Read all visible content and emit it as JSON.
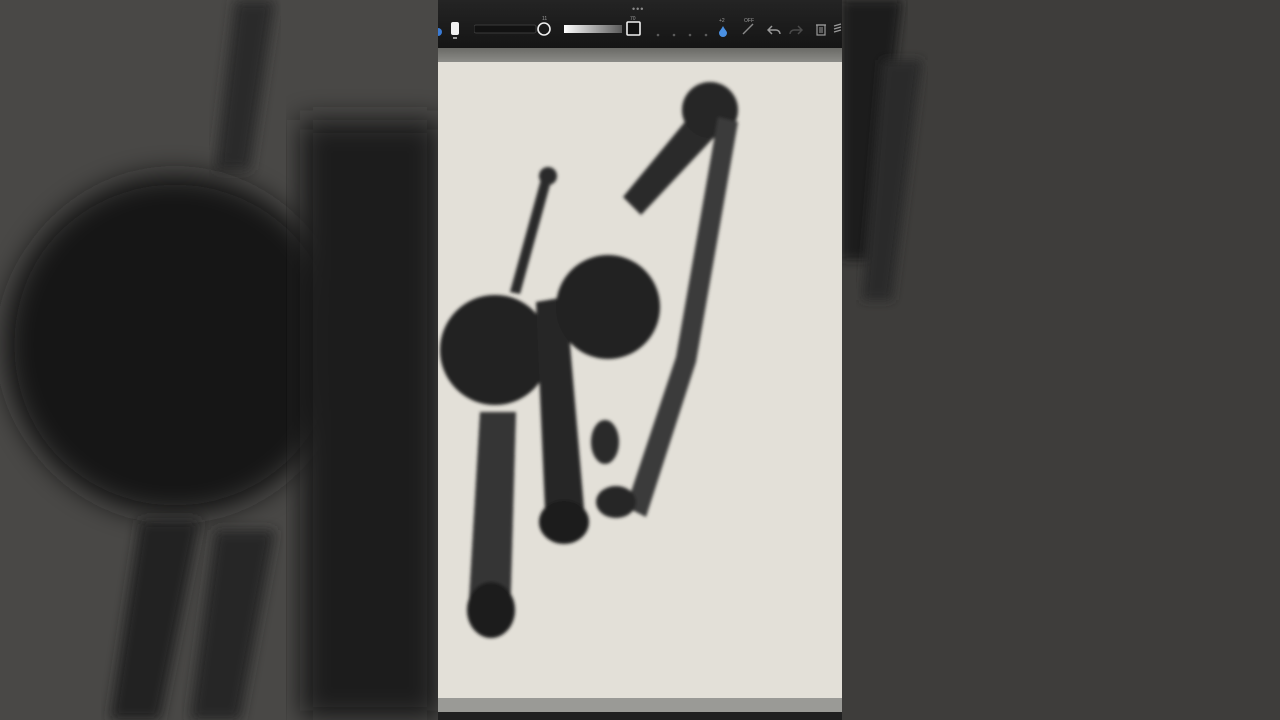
{
  "toolbar": {
    "brush_size_label": "11",
    "opacity_label": "70",
    "stabilizer_label": "OFF",
    "dilution_label": "+2",
    "grabber": "•••"
  },
  "icons": {
    "brush": "brush-icon",
    "size_knob": "circle-icon",
    "opacity_swatch": "square-icon",
    "water": "droplet-icon",
    "stylus": "pen-icon",
    "undo": "undo-icon",
    "redo": "redo-icon",
    "trash": "trash-icon",
    "layers": "layers-icon"
  },
  "colors": {
    "paper": "#e3e0d8",
    "ink": "#1a1a1a",
    "water_accent": "#4a90e2",
    "toolbar": "#1c1c1c"
  }
}
